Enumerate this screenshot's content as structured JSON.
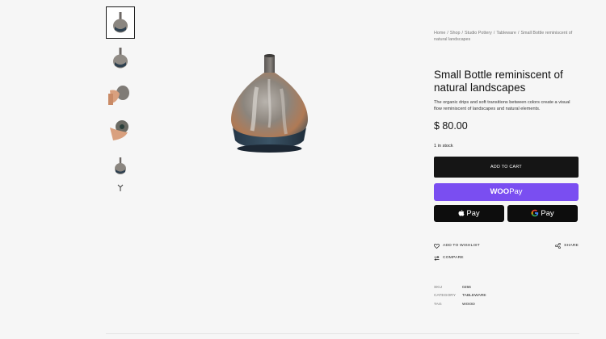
{
  "breadcrumb": [
    "Home",
    "Shop",
    "Studio Pottery",
    "Tableware",
    "Small Bottle reminiscent of natural landscapes"
  ],
  "breadcrumb_separator": "/",
  "product": {
    "title": "Small Bottle reminiscent of natural landscapes",
    "description": "The organic drips and soft transitions between colors create a visual flow reminiscent of landscapes and natural elements.",
    "price": "$ 80.00",
    "stock": "1 in stock"
  },
  "buttons": {
    "add_to_cart": "ADD TO CART",
    "woopay_bold": "WOO",
    "woopay_rest": "Pay",
    "apple_pay": "Pay",
    "google_pay": "Pay"
  },
  "actions": {
    "wishlist": "ADD TO WISHLIST",
    "share": "SHARE",
    "compare": "COMPARE"
  },
  "meta": [
    {
      "key": "SKU",
      "value": "0256"
    },
    {
      "key": "CATEGORY",
      "value": "TABLEWARE"
    },
    {
      "key": "TAG",
      "value": "WOOD"
    }
  ],
  "icons": {
    "thumbnails_more": "chevron-down-icon",
    "wishlist": "heart-icon",
    "share": "share-icon",
    "compare": "compare-arrows-icon"
  },
  "colors": {
    "add_to_cart_bg": "#151515",
    "woopay_bg": "#7a4ef1",
    "wallet_bg": "#0d0d0d",
    "page_bg": "#f6f6f6"
  }
}
